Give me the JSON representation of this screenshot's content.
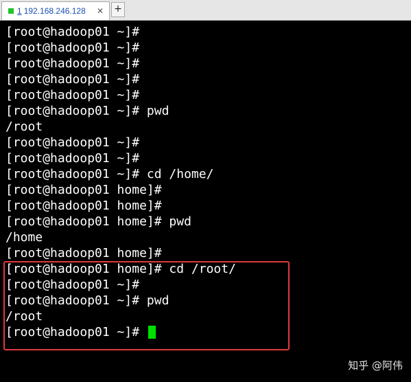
{
  "tab": {
    "number": "1",
    "host": "192.168.246.128",
    "close_glyph": "✕",
    "status_color": "#22c32e"
  },
  "new_tab": {
    "glyph": "+"
  },
  "terminal": {
    "lines": [
      "[root@hadoop01 ~]#",
      "[root@hadoop01 ~]#",
      "[root@hadoop01 ~]#",
      "[root@hadoop01 ~]#",
      "[root@hadoop01 ~]#",
      "[root@hadoop01 ~]# pwd",
      "/root",
      "[root@hadoop01 ~]#",
      "[root@hadoop01 ~]#",
      "[root@hadoop01 ~]# cd /home/",
      "[root@hadoop01 home]#",
      "[root@hadoop01 home]#",
      "[root@hadoop01 home]# pwd",
      "/home",
      "[root@hadoop01 home]#",
      "[root@hadoop01 home]# cd /root/",
      "[root@hadoop01 ~]#",
      "[root@hadoop01 ~]# pwd",
      "/root",
      "[root@hadoop01 ~]#"
    ],
    "text_color": "#ffffff",
    "background": "#000000",
    "cursor_color": "#00e000",
    "highlight_color": "#e0393d"
  },
  "watermark": "知乎 @阿伟"
}
